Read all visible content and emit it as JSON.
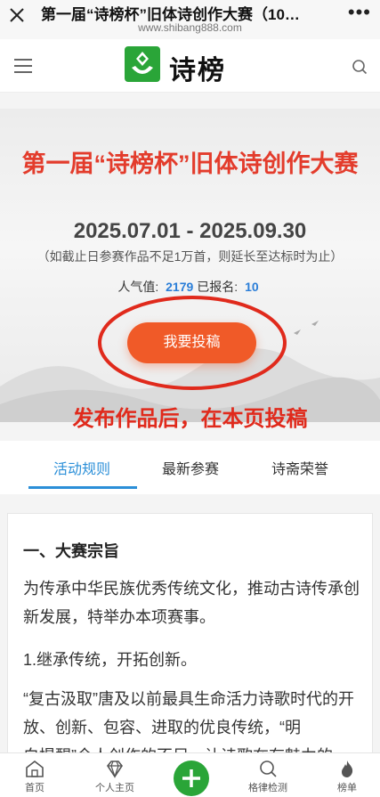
{
  "wx": {
    "title": "第一届“诗榜杯”旧体诗创作大赛（10…",
    "url": "www.shibang888.com",
    "more": "•••"
  },
  "header": {
    "logo_text": "诗榜"
  },
  "banner": {
    "title": "第一届“诗榜杯”旧体诗创作大赛",
    "dates": "2025.07.01 - 2025.09.30",
    "note": "（如截止日参赛作品不足1万首，则延长至达标时为止）",
    "popularity_label": "人气值:",
    "popularity_value": "2179",
    "signup_label": "已报名:",
    "signup_value": "10",
    "submit_label": "我要投稿",
    "annotation": "发布作品后，在本页投稿"
  },
  "tabs": [
    {
      "label": "活动规则",
      "active": true
    },
    {
      "label": "最新参赛",
      "active": false
    },
    {
      "label": "诗斋荣誉",
      "active": false
    }
  ],
  "content": {
    "heading": "一、大赛宗旨",
    "para1": "为传承中华民族优秀传统文化，推动古诗传承创新发展，特举办本项赛事。",
    "para2": "1.继承传统，开拓创新。",
    "para3": "“复古汲取”唐及以前最具生命活力诗歌时代的开放、创新、包容、进取的优良传统，“明",
    "para4": "白提醒”今人创作的不足，让诗歌在有魅力的"
  },
  "bottom_nav": [
    {
      "label": "首页",
      "icon": "home-icon"
    },
    {
      "label": "个人主页",
      "icon": "diamond-icon"
    },
    {
      "label": "",
      "icon": "plus-icon"
    },
    {
      "label": "格律检测",
      "icon": "search-icon"
    },
    {
      "label": "榜单",
      "icon": "fire-icon"
    }
  ],
  "colors": {
    "accent_red": "#e33c2c",
    "button_orange": "#f05a28",
    "link_blue": "#2b8fd8",
    "brand_green": "#2aa538"
  }
}
